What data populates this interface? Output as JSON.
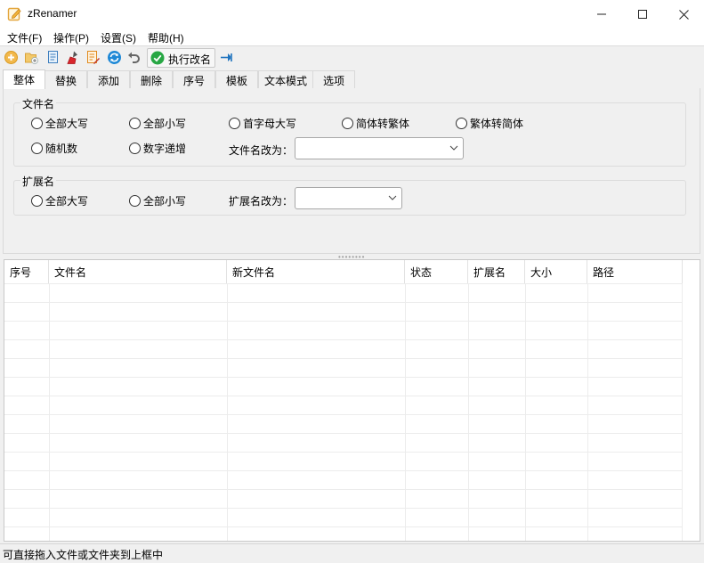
{
  "window": {
    "title": "zRenamer",
    "icon": "pencil-note-icon",
    "controls": [
      "minimize-icon",
      "maximize-icon",
      "close-icon"
    ]
  },
  "menu": [
    "文件(F)",
    "操作(P)",
    "设置(S)",
    "帮助(H)"
  ],
  "toolbar": {
    "icons": [
      "add-file-icon",
      "add-folder-icon",
      "copy-list-icon",
      "clear-list-icon",
      "edit-list-icon",
      "refresh-icon",
      "undo-icon"
    ],
    "execute_label": "执行改名",
    "execute_icon": "green-check-icon",
    "trailing_icon": "pin-icon"
  },
  "tabs": [
    "整体",
    "替换",
    "添加",
    "删除",
    "序号",
    "模板",
    "文本模式",
    "选项"
  ],
  "filename_group": {
    "title": "文件名",
    "options": [
      "全部大写",
      "全部小写",
      "首字母大写",
      "简体转繁体",
      "繁体转简体",
      "随机数",
      "数字递增"
    ],
    "rename_label": "文件名改为：",
    "rename_value": ""
  },
  "extension_group": {
    "title": "扩展名",
    "options": [
      "全部大写",
      "全部小写"
    ],
    "rename_label": "扩展名改为：",
    "rename_value": ""
  },
  "file_list": {
    "columns": [
      "序号",
      "文件名",
      "新文件名",
      "状态",
      "扩展名",
      "大小",
      "路径"
    ],
    "rows": []
  },
  "status": "可直接拖入文件或文件夹到上框中",
  "colors": {
    "accent_check": "#27a744",
    "pin": "#1e73be",
    "clear": "#d9262c",
    "folder": "#e8b64a"
  }
}
